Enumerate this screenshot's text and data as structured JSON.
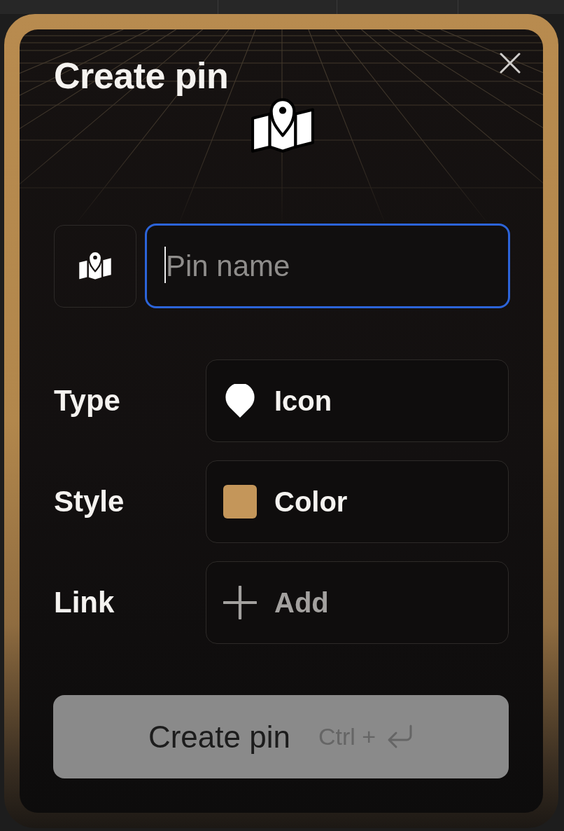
{
  "dialog": {
    "title": "Create pin"
  },
  "name_field": {
    "placeholder": "Pin name",
    "focused": true
  },
  "properties": [
    {
      "label": "Type",
      "kind": "icon",
      "value": "Icon"
    },
    {
      "label": "Style",
      "kind": "color",
      "value": "Color",
      "color": "#c4965a"
    },
    {
      "label": "Link",
      "kind": "add",
      "value": "Add"
    }
  ],
  "submit": {
    "label": "Create pin",
    "shortcut": "Ctrl +",
    "disabled": true
  }
}
